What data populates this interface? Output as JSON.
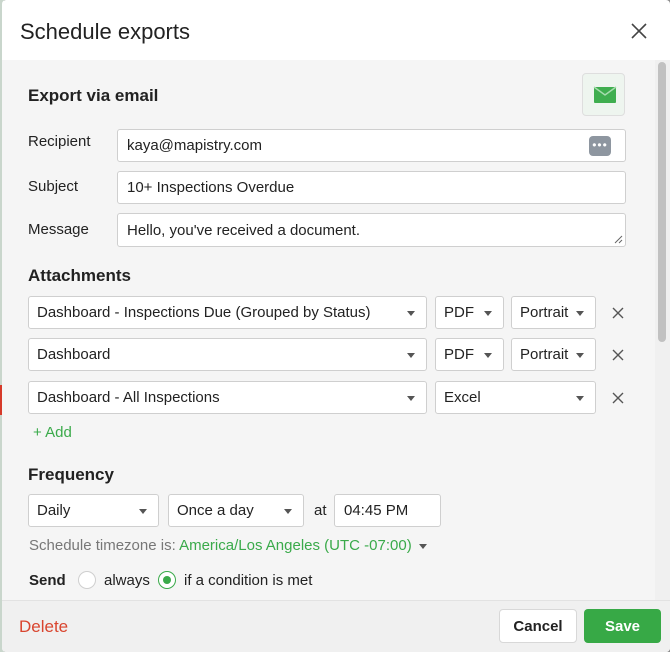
{
  "dialog": {
    "title": "Schedule exports",
    "close_icon": "close-icon"
  },
  "email_section": {
    "heading": "Export via email",
    "badge_icon": "envelope-icon",
    "recipient_label": "Recipient",
    "recipient_value": "kaya@mapistry.com",
    "recipient_side_icon": "password-dots-icon",
    "subject_label": "Subject",
    "subject_value": "10+ Inspections Overdue",
    "message_label": "Message",
    "message_value": "Hello, you've received a document."
  },
  "attachments": {
    "heading": "Attachments",
    "rows": [
      {
        "source": "Dashboard - Inspections Due  (Grouped by Status)",
        "format": "PDF",
        "orientation": "Portrait"
      },
      {
        "source": "Dashboard",
        "format": "PDF",
        "orientation": "Portrait"
      },
      {
        "source": "Dashboard - All Inspections",
        "format": "Excel",
        "orientation": ""
      }
    ],
    "add_label": "+ Add"
  },
  "frequency": {
    "heading": "Frequency",
    "period": "Daily",
    "times": "Once a day",
    "at_label": "at",
    "time": "04:45 PM",
    "timezone_prefix": "Schedule timezone is:",
    "timezone": "America/Los Angeles (UTC -07:00)"
  },
  "send": {
    "label": "Send",
    "options": [
      "always",
      "if a condition is met"
    ],
    "selected": "if a condition is met"
  },
  "footer": {
    "delete_label": "Delete",
    "cancel_label": "Cancel",
    "save_label": "Save"
  },
  "colors": {
    "accent_green": "#37a946",
    "link_green": "#3aaa4a",
    "delete_red": "#d9452f"
  }
}
